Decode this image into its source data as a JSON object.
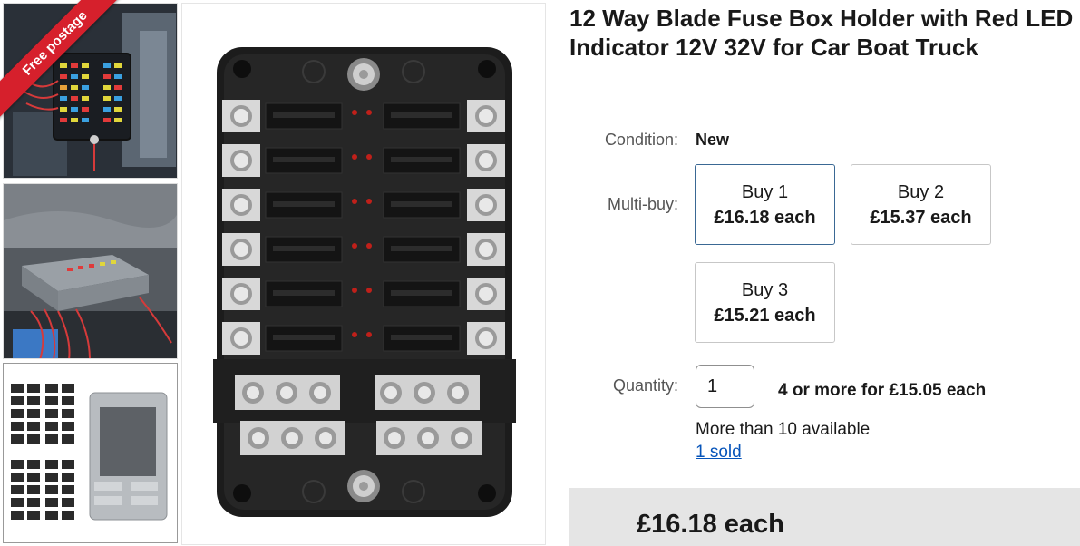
{
  "badge": {
    "text": "Free postage"
  },
  "product": {
    "title": "12 Way Blade Fuse Box Holder with Red LED Indicator 12V 32V for Car Boat Truck"
  },
  "condition": {
    "label": "Condition:",
    "value": "New"
  },
  "multibuy": {
    "label": "Multi-buy:",
    "options": [
      {
        "qty": "Buy 1",
        "price": "£16.18 each",
        "selected": true
      },
      {
        "qty": "Buy 2",
        "price": "£15.37 each",
        "selected": false
      },
      {
        "qty": "Buy 3",
        "price": "£15.21 each",
        "selected": false
      }
    ]
  },
  "quantity": {
    "label": "Quantity:",
    "value": "1",
    "offer": "4 or more for £15.05 each",
    "available": "More than 10 available",
    "sold": "1 sold"
  },
  "price": {
    "display": "£16.18 each"
  },
  "colors": {
    "link": "#0654ba",
    "badge": "#d6202c",
    "selected_border": "#3a6894"
  }
}
